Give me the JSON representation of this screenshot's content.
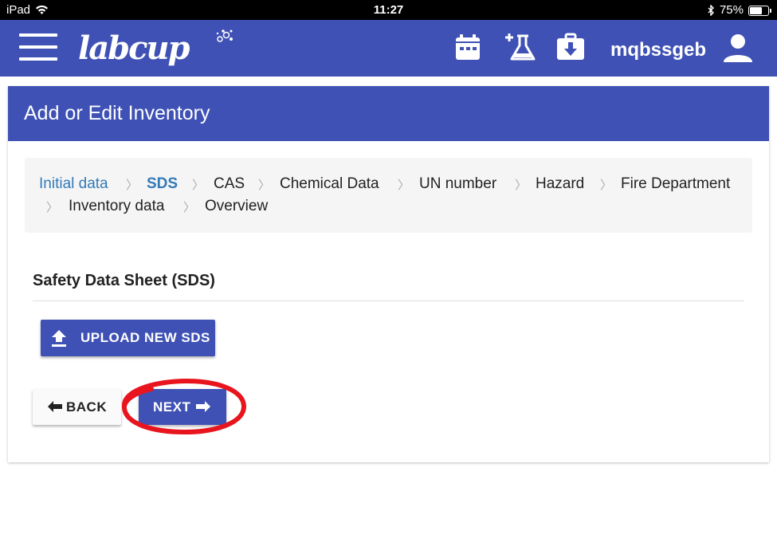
{
  "status_bar": {
    "device": "iPad",
    "time": "11:27",
    "battery": "75%",
    "battery_level": 0.75,
    "icons": [
      "wifi-icon",
      "bluetooth-icon",
      "battery-icon"
    ]
  },
  "app_bar": {
    "logo": "labcup",
    "username": "mqbssgeb",
    "icons": [
      "menu-icon",
      "calendar-icon",
      "add-flask-icon",
      "briefcase-download-icon",
      "user-icon"
    ]
  },
  "card": {
    "title": "Add or Edit Inventory"
  },
  "breadcrumb": {
    "items": [
      {
        "label": "Initial data",
        "state": "done"
      },
      {
        "label": "SDS",
        "state": "active"
      },
      {
        "label": "CAS",
        "state": "todo"
      },
      {
        "label": "Chemical Data",
        "state": "todo"
      },
      {
        "label": "UN number",
        "state": "todo"
      },
      {
        "label": "Hazard",
        "state": "todo"
      },
      {
        "label": "Fire Department",
        "state": "todo"
      },
      {
        "label": "Inventory data",
        "state": "todo"
      },
      {
        "label": "Overview",
        "state": "todo"
      }
    ],
    "separator": "〉"
  },
  "section": {
    "title": "Safety Data Sheet (SDS)"
  },
  "buttons": {
    "upload": "UPLOAD NEW SDS",
    "back": "BACK",
    "next": "NEXT"
  },
  "colors": {
    "primary": "#3f51b5",
    "link": "#337ab7",
    "annotation": "#e8141e"
  }
}
